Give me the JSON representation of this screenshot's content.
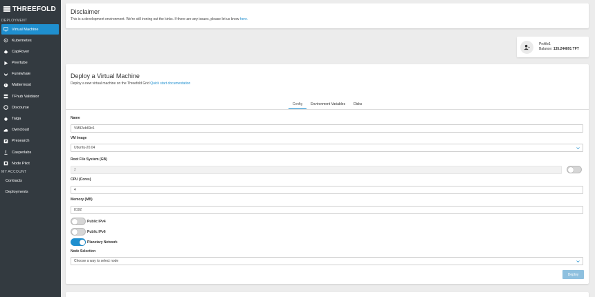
{
  "brand": {
    "name": "THREEFOLD"
  },
  "sidebar": {
    "deployment_label": "DEPLOYMENT",
    "account_label": "MY ACCOUNT",
    "items": [
      {
        "label": "Virtual Machine",
        "icon": "monitor-icon"
      },
      {
        "label": "Kubernetes",
        "icon": "kubernetes-icon"
      },
      {
        "label": "CapRover",
        "icon": "caprover-icon"
      },
      {
        "label": "Peertube",
        "icon": "play-icon"
      },
      {
        "label": "Funkwhale",
        "icon": "funkwhale-icon"
      },
      {
        "label": "Mattermost",
        "icon": "mattermost-icon"
      },
      {
        "label": "TFhub Validator",
        "icon": "server-icon"
      },
      {
        "label": "Discourse",
        "icon": "chat-icon"
      },
      {
        "label": "Taiga",
        "icon": "taiga-icon"
      },
      {
        "label": "Owncloud",
        "icon": "cloud-icon"
      },
      {
        "label": "Presearch",
        "icon": "search-icon"
      },
      {
        "label": "Casperlabs",
        "icon": "casper-icon"
      },
      {
        "label": "Node Pilot",
        "icon": "nodepilot-icon"
      }
    ],
    "account_items": [
      {
        "label": "Contracts"
      },
      {
        "label": "Deployments"
      }
    ]
  },
  "disclaimer": {
    "title": "Disclaimer",
    "text": "This is a development environment. We're still ironing out the kinks. If there are any issues, please let us know ",
    "link": "here."
  },
  "profile": {
    "name": "Profile1",
    "balance_label": "Balance: ",
    "balance_value": "135.244891 TFT"
  },
  "deploy": {
    "title": "Deploy a Virtual Machine",
    "subtitle": "Deploy a new virtual machine on the Threefold Grid ",
    "subtitle_link": "Quick start documentation",
    "tabs": [
      "Config",
      "Environment Variables",
      "Disks"
    ],
    "name_label": "Name",
    "name_value": "VM92eb69c6",
    "image_label": "VM Image",
    "image_value": "Ubuntu-20.04",
    "rootfs_label": "Root File System (GB)",
    "rootfs_value": "2",
    "cpu_label": "CPU (Cores)",
    "cpu_value": "4",
    "memory_label": "Memory (MB)",
    "memory_value": "8192",
    "ipv4_label": "Public IPv4",
    "ipv6_label": "Public IPv6",
    "planetary_label": "Planetary Network",
    "node_label": "Node Selection",
    "node_placeholder": "Choose a way to select node",
    "deploy_button": "Deploy"
  }
}
